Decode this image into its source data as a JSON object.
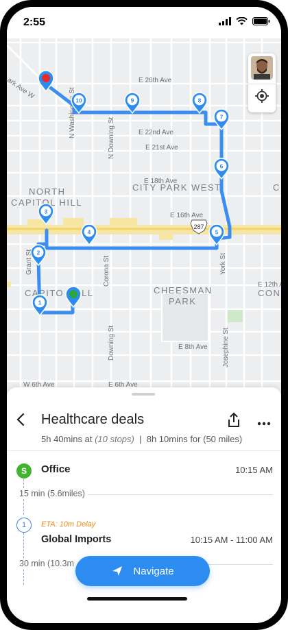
{
  "status_bar": {
    "time": "2:55"
  },
  "map": {
    "streets": {
      "e26th": "E 26th Ave",
      "e22nd": "E 22nd Ave",
      "e21st": "E 21st Ave",
      "e18th": "E 18th Ave",
      "e16th": "E 16th Ave",
      "e12th": "E 12th Ave",
      "e8th": "E 8th Ave",
      "w6th": "W 6th Ave",
      "e6th": "E 6th Ave",
      "parkave": "ark Ave W",
      "nwashington": "N Washington St",
      "ndowning": "N Downing St",
      "corona": "Corona St",
      "downing": "Downing St",
      "grant": "Grant St",
      "york": "York St",
      "josephine": "Josephine St",
      "highway": "287"
    },
    "neighborhoods": {
      "north_capitol_hill_1": "NORTH",
      "north_capitol_hill_2": "CAPITOL HILL",
      "city_park_west": "CITY PARK WEST",
      "capitol_hill_1": "CAPITO",
      "capitol_hill_2": "ILL",
      "cheesman_1": "CHEESMAN",
      "cheesman_2": "PARK",
      "con": "CON",
      "ci": "CI"
    },
    "stop_labels": [
      "1",
      "2",
      "3",
      "4",
      "5",
      "6",
      "7",
      "8",
      "9",
      "10"
    ],
    "colors": {
      "route": "#3b8ef0",
      "start": "#2aa63b",
      "end": "#e82a2a",
      "marker": "#2d8cf0"
    }
  },
  "route": {
    "title": "Healthcare deals",
    "summary_time": "5h 40mins at",
    "summary_stops": "(10 stops)",
    "summary_sep": "|",
    "summary_time2": "8h 10mins for",
    "summary_miles": "(50 miles)"
  },
  "stops": [
    {
      "badge": "S",
      "name": "Office",
      "time": "10:15 AM",
      "next_leg": "15 min (5.6miles)"
    },
    {
      "badge": "1",
      "eta": "ETA: 10m Delay",
      "name": "Global Imports",
      "time": "10:15 AM - 11:00 AM",
      "next_leg": "30 min (10.3m"
    }
  ],
  "actions": {
    "navigate": "Navigate"
  }
}
